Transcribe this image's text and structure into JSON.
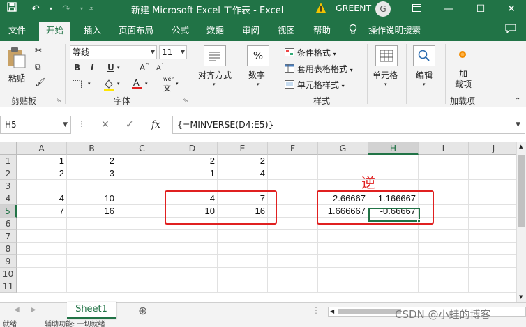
{
  "titlebar": {
    "title": "新建 Microsoft Excel 工作表  -  Excel",
    "user": "GREENT",
    "avatar": "G",
    "save_icon": "save-icon",
    "undo_icon": "undo-icon",
    "redo_icon": "redo-icon"
  },
  "tabs": [
    "文件",
    "开始",
    "插入",
    "页面布局",
    "公式",
    "数据",
    "审阅",
    "视图",
    "帮助",
    "操作说明搜索"
  ],
  "ribbon": {
    "clipboard": {
      "paste": "粘贴",
      "label": "剪贴板"
    },
    "font": {
      "name": "等线",
      "size": "11",
      "label": "字体",
      "wen": "wén",
      "wen2": "文"
    },
    "alignment": {
      "label": "对齐方式"
    },
    "number": {
      "label": "数字",
      "symbol": "%"
    },
    "styles": {
      "cond": "条件格式",
      "table": "套用表格格式",
      "cell": "单元格样式",
      "label": "样式"
    },
    "cells": {
      "label": "单元格"
    },
    "editing": {
      "label": "编辑"
    },
    "addins": {
      "btn": "加\n载项",
      "btn1": "加",
      "btn2": "载项",
      "label": "加载项"
    }
  },
  "formula_bar": {
    "name_box": "H5",
    "formula": "{=MINVERSE(D4:E5)}"
  },
  "columns": [
    "A",
    "B",
    "C",
    "D",
    "E",
    "F",
    "G",
    "H",
    "I",
    "J"
  ],
  "rows": [
    "1",
    "2",
    "3",
    "4",
    "5",
    "6",
    "7",
    "8",
    "9",
    "10",
    "11"
  ],
  "cells": {
    "A1": "1",
    "B1": "2",
    "D1": "2",
    "E1": "2",
    "A2": "2",
    "B2": "3",
    "D2": "1",
    "E2": "4",
    "A4": "4",
    "B4": "10",
    "D4": "4",
    "E4": "7",
    "G4": "-2.66667",
    "H4": "1.166667",
    "A5": "7",
    "B5": "16",
    "D5": "10",
    "E5": "16",
    "G5": "1.666667",
    "H5": "-0.66667"
  },
  "annotation": "逆",
  "selected_cell": "H5",
  "sheet_tab": "Sheet1",
  "watermark": "CSDN @小蛙的博客",
  "status": {
    "left1": "就绪",
    "left2": "辅助功能: 一切就绪"
  },
  "colors": {
    "brand": "#217346",
    "annotation": "#e02020"
  }
}
